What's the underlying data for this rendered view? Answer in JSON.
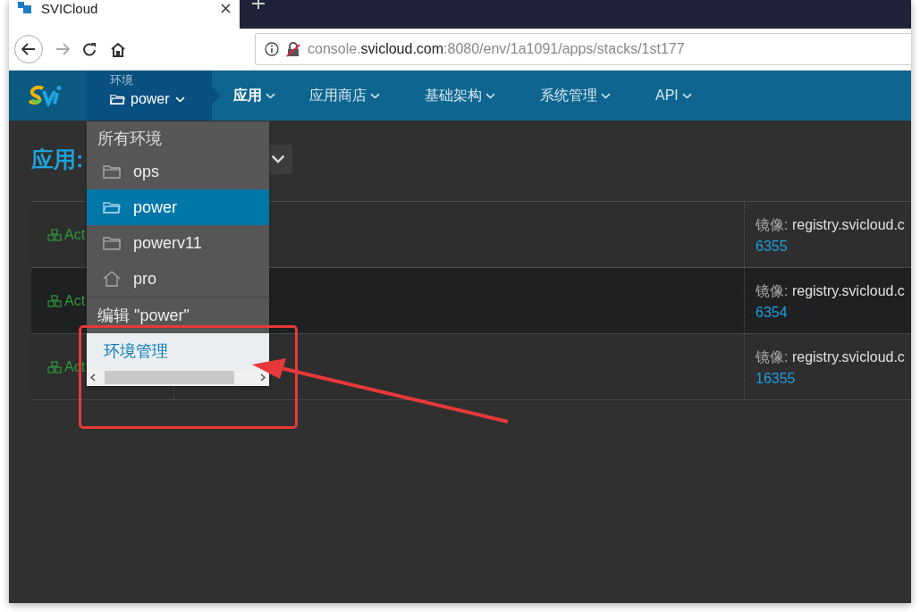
{
  "browser": {
    "tab_title": "SVICloud",
    "url": {
      "prefix": "console.",
      "domain": "svicloud.com",
      "path": ":8080/env/1a1091/apps/stacks/1st177"
    }
  },
  "navbar": {
    "environment": {
      "label": "环境",
      "value": "power"
    },
    "menus": [
      {
        "label": "应用",
        "selected": true
      },
      {
        "label": "应用商店",
        "selected": false
      },
      {
        "label": "基础架构",
        "selected": false
      },
      {
        "label": "系统管理",
        "selected": false
      },
      {
        "label": "API",
        "selected": false
      }
    ]
  },
  "page": {
    "title": "应用:"
  },
  "stacks": [
    {
      "state": "Act",
      "image_label": "镜像:",
      "image": "registry.svicloud.c",
      "port": "6355"
    },
    {
      "state": "Act",
      "image_label": "镜像:",
      "image": "registry.svicloud.c",
      "port": "6354"
    },
    {
      "state": "Act",
      "image_label": "镜像:",
      "image": "registry.svicloud.c",
      "port": "16355"
    }
  ],
  "env_menu": {
    "header": "所有环境",
    "items": [
      {
        "name": "ops",
        "kind": "folder",
        "selected": false
      },
      {
        "name": "power",
        "kind": "folder",
        "selected": true
      },
      {
        "name": "powerv11",
        "kind": "folder",
        "selected": false
      },
      {
        "name": "pro",
        "kind": "home",
        "selected": false
      }
    ],
    "edit": "编辑 \"power\"",
    "manage": "环境管理"
  }
}
